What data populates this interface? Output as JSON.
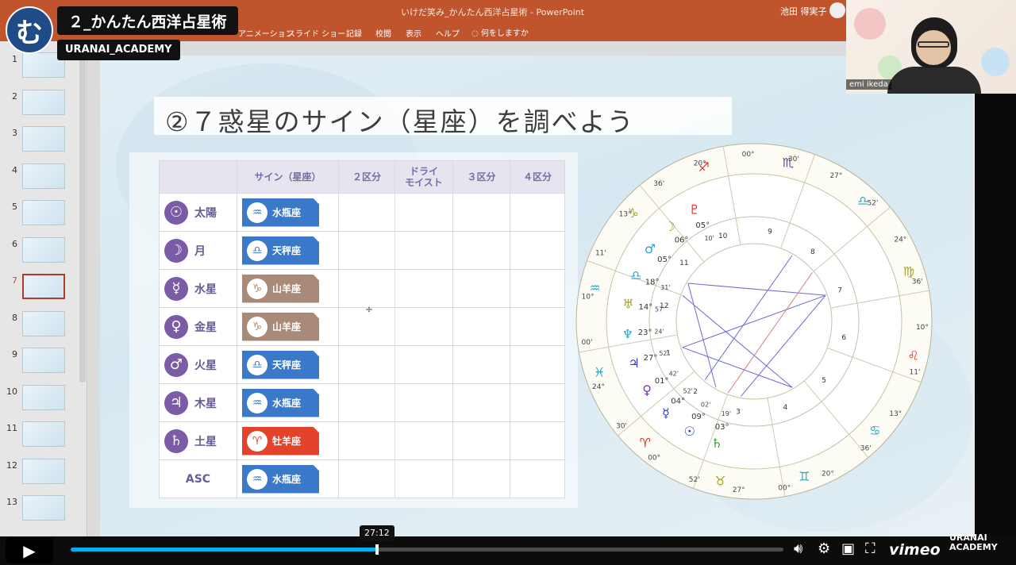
{
  "window": {
    "title": "いけだ笑み_かんたん西洋占星術 - PowerPoint",
    "user": "池田 得実子"
  },
  "ribbon": {
    "tabs": [
      "アニメーション",
      "スライド ショー",
      "記録",
      "校閲",
      "表示",
      "ヘルプ"
    ],
    "search": "何をしますか"
  },
  "thumbnails": {
    "numbers": [
      "1",
      "2",
      "3",
      "4",
      "5",
      "6",
      "7",
      "8",
      "9",
      "10",
      "11",
      "12",
      "13"
    ],
    "active": "7"
  },
  "overlay": {
    "logo_glyph": "む",
    "course_title": "２_かんたん西洋占星術",
    "academy": "URANAI_ACADEMY"
  },
  "webcam": {
    "name": "emi ikeda"
  },
  "slide": {
    "title": "②７惑星のサイン（星座）を調べよう",
    "table": {
      "headers": [
        "",
        "サイン（星座）",
        "２区分",
        "ドライ\nモイスト",
        "３区分",
        "４区分"
      ],
      "rows": [
        {
          "planet_glyph": "☉",
          "planet": "太陽",
          "sign_glyph": "♒",
          "sign": "水瓶座",
          "color": "#3a78c9"
        },
        {
          "planet_glyph": "☽",
          "planet": "月",
          "sign_glyph": "♎",
          "sign": "天秤座",
          "color": "#3a78c9"
        },
        {
          "planet_glyph": "☿",
          "planet": "水星",
          "sign_glyph": "♑",
          "sign": "山羊座",
          "color": "#a98a78"
        },
        {
          "planet_glyph": "♀",
          "planet": "金星",
          "sign_glyph": "♑",
          "sign": "山羊座",
          "color": "#a98a78"
        },
        {
          "planet_glyph": "♂",
          "planet": "火星",
          "sign_glyph": "♎",
          "sign": "天秤座",
          "color": "#3a78c9"
        },
        {
          "planet_glyph": "♃",
          "planet": "木星",
          "sign_glyph": "♒",
          "sign": "水瓶座",
          "color": "#3a78c9"
        },
        {
          "planet_glyph": "♄",
          "planet": "土星",
          "sign_glyph": "♈",
          "sign": "牡羊座",
          "color": "#e2432a"
        },
        {
          "planet_glyph": "",
          "planet": "ASC",
          "sign_glyph": "♒",
          "sign": "水瓶座",
          "color": "#3a78c9"
        }
      ]
    }
  },
  "natal_chart": {
    "signs": [
      {
        "glyph": "♏",
        "color": "#6a3aa8"
      },
      {
        "glyph": "♎",
        "color": "#2aa6c9"
      },
      {
        "glyph": "♍",
        "color": "#a7a02a"
      },
      {
        "glyph": "♌",
        "color": "#d9352a"
      },
      {
        "glyph": "♋",
        "color": "#2aa6c9"
      },
      {
        "glyph": "♊",
        "color": "#2aa6c9"
      },
      {
        "glyph": "♉",
        "color": "#a7a02a"
      },
      {
        "glyph": "♈",
        "color": "#d9352a"
      },
      {
        "glyph": "♓",
        "color": "#2aa6c9"
      },
      {
        "glyph": "♒",
        "color": "#2aa6c9"
      },
      {
        "glyph": "♑",
        "color": "#a7a02a"
      },
      {
        "glyph": "♐",
        "color": "#d9352a"
      }
    ],
    "degree_labels": [
      "00°",
      "30'",
      "27°",
      "52'",
      "24°",
      "36'",
      "10°",
      "11'",
      "13°",
      "36'",
      "20°",
      "00°",
      "27°",
      "52'",
      "00°",
      "30'",
      "24°",
      "00'",
      "10°",
      "11'",
      "13°",
      "36'",
      "20°"
    ],
    "houses": [
      "1",
      "2",
      "3",
      "4",
      "5",
      "6",
      "7",
      "8",
      "9",
      "10",
      "11",
      "12"
    ],
    "planets": [
      {
        "glyph": "♇",
        "deg": "05°",
        "min": "10'",
        "color": "#d9352a"
      },
      {
        "glyph": "☽",
        "deg": "06°",
        "min": "",
        "color": "#a7a02a"
      },
      {
        "glyph": "♂",
        "deg": "05°",
        "min": "",
        "color": "#2aa6c9"
      },
      {
        "glyph": "♎",
        "deg": "18°",
        "min": "31'",
        "color": "#2aa6c9"
      },
      {
        "glyph": "♅",
        "deg": "14°",
        "min": "57'",
        "color": "#a7a02a"
      },
      {
        "glyph": "♆",
        "deg": "23°",
        "min": "24'",
        "color": "#2aa6c9"
      },
      {
        "glyph": "♃",
        "deg": "27°",
        "min": "52'",
        "color": "#2a3ac9"
      },
      {
        "glyph": "♀",
        "deg": "01°",
        "min": "42'",
        "color": "#7a3aa8"
      },
      {
        "glyph": "☿",
        "deg": "04°",
        "min": "52'",
        "color": "#2a3ac9"
      },
      {
        "glyph": "☉",
        "deg": "09°",
        "min": "02'",
        "color": "#2a3ac9"
      },
      {
        "glyph": "♄",
        "deg": "03°",
        "min": "19'",
        "color": "#2a9a2a"
      }
    ]
  },
  "player": {
    "time": "27:12",
    "progress": 0.43,
    "vimeo": "vimeo",
    "watermark": "URANAI\nACADEMY"
  }
}
